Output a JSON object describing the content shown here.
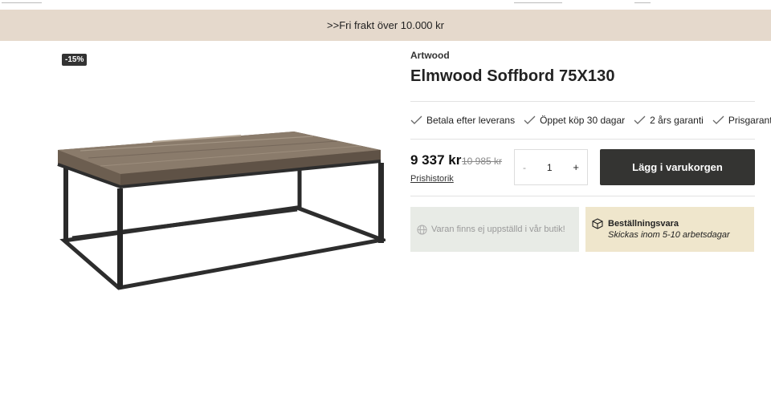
{
  "banner": {
    "text": ">>Fri frakt över 10.000 kr"
  },
  "gallery": {
    "discount_badge": "-15%"
  },
  "product": {
    "brand": "Artwood",
    "title": "Elmwood Soffbord 75X130",
    "usps": [
      "Betala efter leverans",
      "Öppet köp 30 dagar",
      "2 års garanti",
      "Prisgaranti"
    ],
    "price": "9 337 kr",
    "old_price": "10 985 kr",
    "price_history_link": "Prishistorik",
    "quantity": {
      "minus": "-",
      "value": "1",
      "plus": "+"
    },
    "add_to_cart": "Lägg i varukorgen",
    "store_availability": "Varan finns ej uppställd i vår butik!",
    "order_item": {
      "title": "Beställningsvara",
      "subtitle": "Skickas inom 5-10 arbetsdagar"
    }
  },
  "colors": {
    "banner_bg": "#e5d9cc",
    "button_bg": "#343432",
    "card_grey": "#e8ebe6",
    "card_beige": "#efe6cc"
  }
}
